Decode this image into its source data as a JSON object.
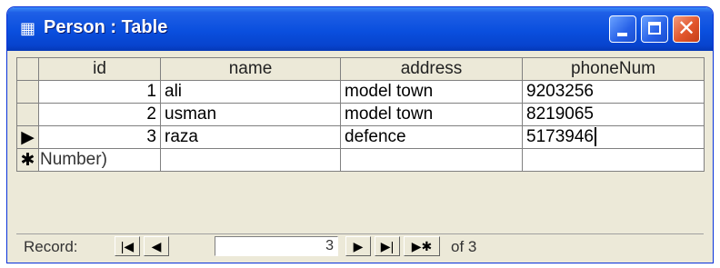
{
  "window": {
    "title": "Person : Table"
  },
  "table": {
    "columns": [
      "id",
      "name",
      "address",
      "phoneNum"
    ],
    "rows": [
      {
        "id": "1",
        "name": "ali",
        "address": "model town",
        "phoneNum": "9203256"
      },
      {
        "id": "2",
        "name": "usman",
        "address": "model town",
        "phoneNum": "8219065"
      },
      {
        "id": "3",
        "name": "raza",
        "address": "defence",
        "phoneNum": "5173946"
      }
    ],
    "new_row_marker": "✱",
    "new_row_id_placeholder": "Number)"
  },
  "navigation": {
    "record_label": "Record:",
    "current_record": "3",
    "of_text": "of 3"
  }
}
